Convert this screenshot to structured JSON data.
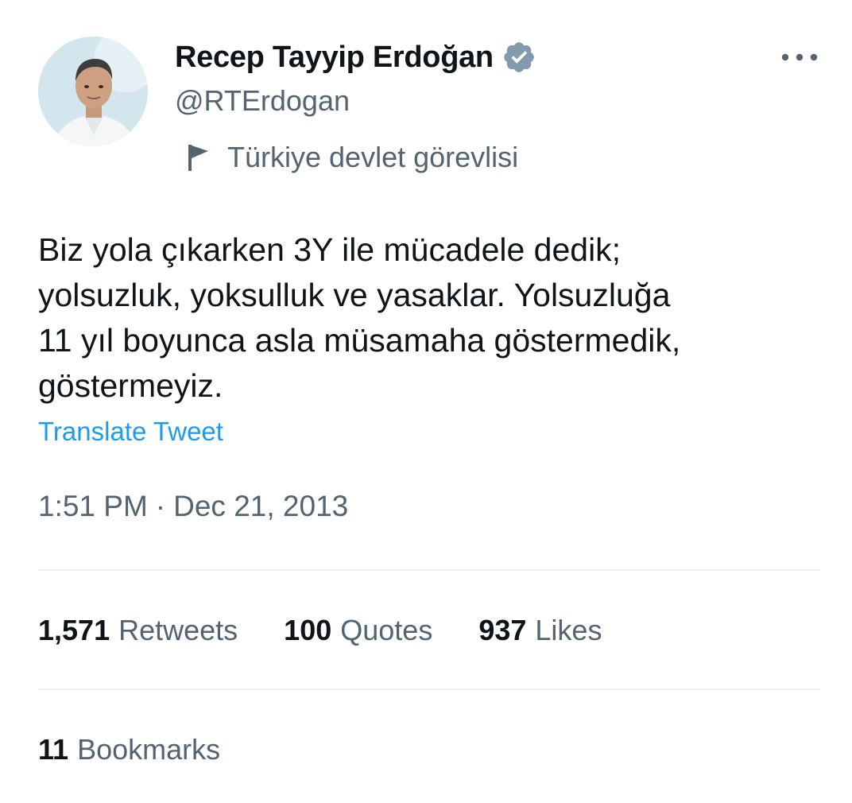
{
  "author": {
    "display_name": "Recep Tayyip Erdoğan",
    "handle": "@RTErdogan",
    "verified_icon": "verified-badge-icon",
    "verified_color": "#829aab",
    "label": "Türkiye devlet görevlisi",
    "label_icon": "flag-icon"
  },
  "tweet": {
    "text": "Biz yola çıkarken 3Y ile mücadele dedik;\nyolsuzluk, yoksulluk ve yasaklar. Yolsuzluğa\n11 yıl boyunca asla müsamaha göstermedik,\ngöstermeyiz.",
    "translate_label": "Translate Tweet",
    "time": "1:51 PM",
    "separator": "·",
    "date": "Dec 21, 2013"
  },
  "stats": {
    "retweets_count": "1,571",
    "retweets_label": "Retweets",
    "quotes_count": "100",
    "quotes_label": "Quotes",
    "likes_count": "937",
    "likes_label": "Likes",
    "bookmarks_count": "11",
    "bookmarks_label": "Bookmarks"
  },
  "colors": {
    "text_primary": "#0f1419",
    "text_secondary": "#536471",
    "link": "#1d9bf0",
    "divider": "#eff3f4"
  }
}
